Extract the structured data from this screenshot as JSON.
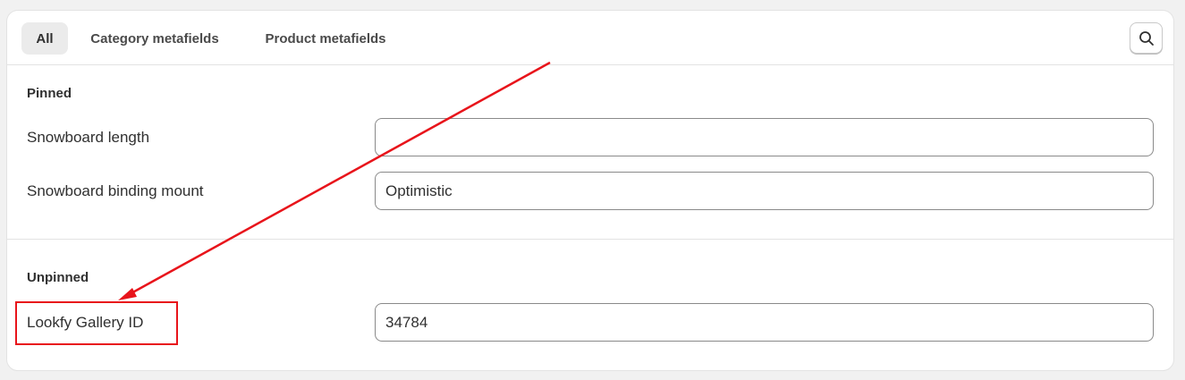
{
  "tabs": [
    {
      "label": "All",
      "active": true
    },
    {
      "label": "Category metafields",
      "active": false
    },
    {
      "label": "Product metafields",
      "active": false
    }
  ],
  "search": {
    "icon": "search-icon"
  },
  "pinned": {
    "title": "Pinned",
    "rows": [
      {
        "label": "Snowboard length",
        "value": ""
      },
      {
        "label": "Snowboard binding mount",
        "value": "Optimistic"
      }
    ]
  },
  "unpinned": {
    "title": "Unpinned",
    "rows": [
      {
        "label": "Lookfy Gallery ID",
        "value": "34784"
      }
    ]
  },
  "annotation": {
    "color": "#e8141b"
  }
}
